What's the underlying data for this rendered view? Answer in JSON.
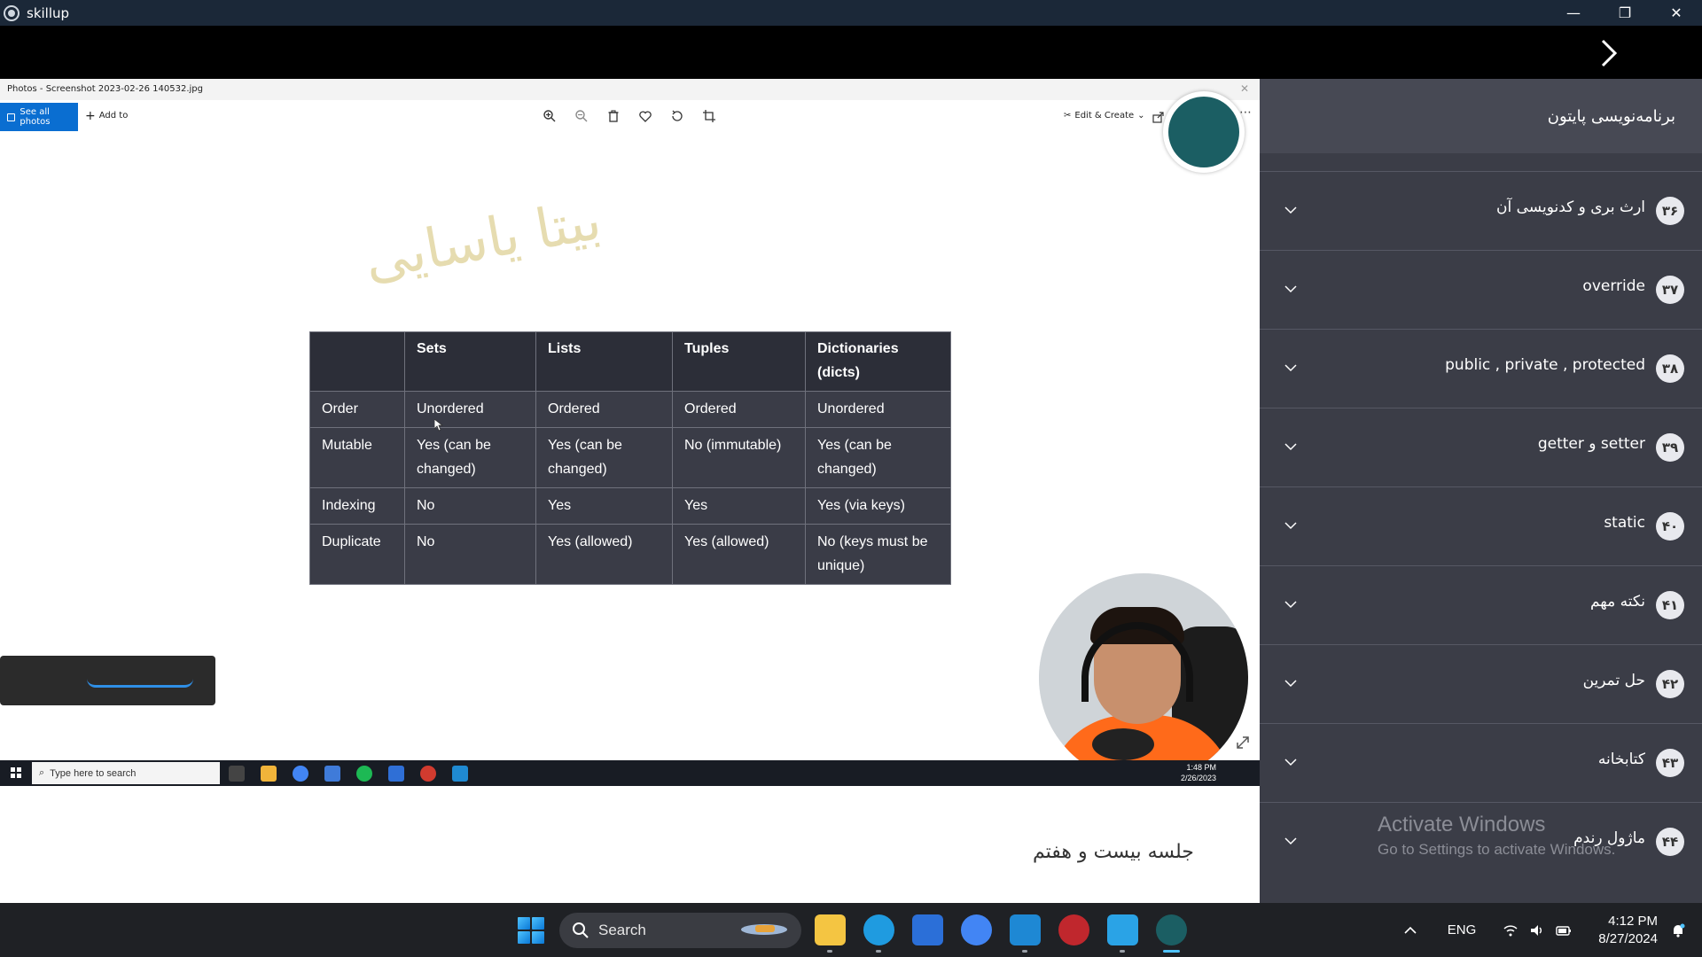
{
  "app": {
    "title": "skillup",
    "controls": {
      "minimize": "—",
      "restore": "❐",
      "close": "✕"
    }
  },
  "photos": {
    "window_title": "Photos - Screenshot 2023-02-26 140532.jpg",
    "see_all_label": "See all photos",
    "add_to_label": "Add to",
    "edit_create_label": "Edit & Create"
  },
  "slide": {
    "watermark": "بیتا یاسایی",
    "table": {
      "headers": [
        "",
        "Sets",
        "Lists",
        "Tuples",
        "Dictionaries (dicts)"
      ],
      "rows": [
        [
          "Order",
          "Unordered",
          "Ordered",
          "Ordered",
          "Unordered"
        ],
        [
          "Mutable",
          "Yes (can be changed)",
          "Yes (can be changed)",
          "No (immutable)",
          "Yes (can be changed)"
        ],
        [
          "Indexing",
          "No",
          "Yes",
          "Yes",
          "Yes (via keys)"
        ],
        [
          "Duplicate",
          "No",
          "Yes (allowed)",
          "Yes (allowed)",
          "No (keys must be unique)"
        ]
      ]
    }
  },
  "inner_taskbar": {
    "search_placeholder": "Type here to search",
    "time": "1:48 PM",
    "date": "2/26/2023"
  },
  "lesson": {
    "title": "جلسه بیست و هفتم"
  },
  "sidebar": {
    "title": "برنامه‌نویسی پایتون",
    "items": [
      {
        "num": "۳۶",
        "label": "ارث بری و کدنویسی آن"
      },
      {
        "num": "۳۷",
        "label": "override"
      },
      {
        "num": "۳۸",
        "label": "public , private , protected"
      },
      {
        "num": "۳۹",
        "label": "setter و getter"
      },
      {
        "num": "۴۰",
        "label": "static"
      },
      {
        "num": "۴۱",
        "label": "نکته مهم"
      },
      {
        "num": "۴۲",
        "label": "حل تمرین"
      },
      {
        "num": "۴۳",
        "label": "کتابخانه"
      },
      {
        "num": "۴۴",
        "label": "ماژول رندم"
      }
    ]
  },
  "activation": {
    "title": "Activate Windows",
    "subtitle": "Go to Settings to activate Windows."
  },
  "taskbar": {
    "search_label": "Search",
    "language": "ENG",
    "time": "4:12 PM",
    "date": "8/27/2024"
  },
  "colors": {
    "sidebar_bg": "#3b3d47",
    "table_bg": "#3a3c47",
    "accent_blue": "#0a6ed1",
    "titlebar_bg": "#1b2838"
  }
}
